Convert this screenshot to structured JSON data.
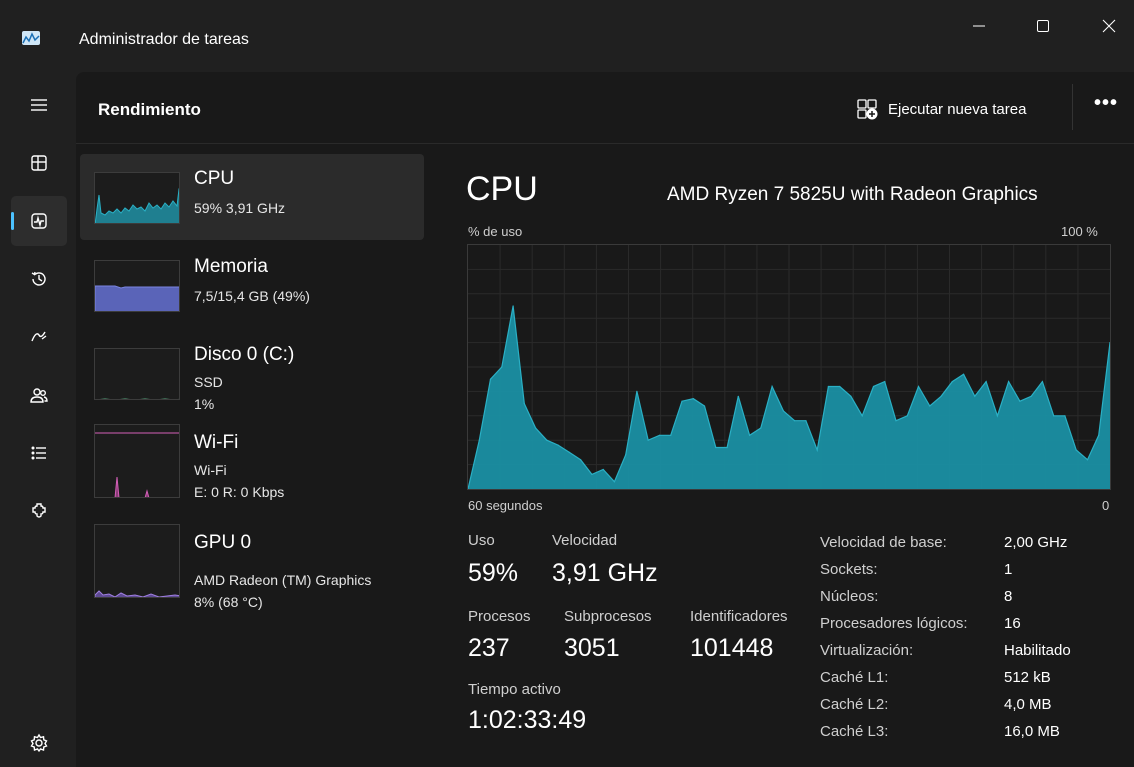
{
  "app": {
    "title": "Administrador de tareas"
  },
  "window_controls": [
    "minimize",
    "maximize",
    "close"
  ],
  "nav": {
    "items": [
      {
        "icon": "menu-icon"
      },
      {
        "icon": "processes-icon"
      },
      {
        "icon": "performance-icon",
        "active": true
      },
      {
        "icon": "history-icon"
      },
      {
        "icon": "startup-icon"
      },
      {
        "icon": "users-icon"
      },
      {
        "icon": "details-icon"
      },
      {
        "icon": "services-icon"
      },
      {
        "icon": "settings-icon"
      }
    ]
  },
  "header": {
    "title": "Rendimiento",
    "run_task": "Ejecutar nueva tarea",
    "more": "•••"
  },
  "devices": [
    {
      "name": "CPU",
      "line1": "59% 3,91 GHz",
      "color": "#2ab0c5",
      "active": true
    },
    {
      "name": "Memoria",
      "line1": "7,5/15,4 GB (49%)",
      "color": "#7a85e0"
    },
    {
      "name": "Disco 0 (C:)",
      "line1": "SSD",
      "line2": "1%",
      "color": "#5fb88a"
    },
    {
      "name": "Wi-Fi",
      "line1": "Wi-Fi",
      "line2": "E: 0 R: 0 Kbps",
      "color": "#d35fb7"
    },
    {
      "name": "GPU 0",
      "line1": "AMD Radeon (TM) Graphics",
      "line2": "8% (68 °C)",
      "color": "#9f7fe0"
    }
  ],
  "detail": {
    "title": "CPU",
    "model": "AMD Ryzen 7 5825U with Radeon Graphics",
    "usage_label": "% de uso",
    "max_label": "100 %",
    "time_label": "60 segundos",
    "min_label": "0",
    "stats": {
      "uso_label": "Uso",
      "uso": "59%",
      "velocidad_label": "Velocidad",
      "velocidad": "3,91 GHz",
      "procesos_label": "Procesos",
      "procesos": "237",
      "subprocesos_label": "Subprocesos",
      "subprocesos": "3051",
      "identificadores_label": "Identificadores",
      "identificadores": "101448",
      "tiempo_label": "Tiempo activo",
      "tiempo": "1:02:33:49"
    },
    "specs": [
      {
        "label": "Velocidad de base:",
        "value": "2,00 GHz"
      },
      {
        "label": "Sockets:",
        "value": "1"
      },
      {
        "label": "Núcleos:",
        "value": "8"
      },
      {
        "label": "Procesadores lógicos:",
        "value": "16"
      },
      {
        "label": "Virtualización:",
        "value": "Habilitado"
      },
      {
        "label": "Caché L1:",
        "value": "512 kB"
      },
      {
        "label": "Caché L2:",
        "value": "4,0 MB"
      },
      {
        "label": "Caché L3:",
        "value": "16,0 MB"
      }
    ]
  },
  "chart_data": {
    "type": "area",
    "ylim": [
      0,
      100
    ],
    "grid": true,
    "color": "#2ab0c5",
    "values": [
      0,
      20,
      45,
      50,
      75,
      35,
      25,
      20,
      18,
      15,
      12,
      6,
      8,
      3,
      14,
      40,
      20,
      22,
      22,
      36,
      37,
      34,
      17,
      17,
      38,
      22,
      25,
      42,
      32,
      28,
      28,
      16,
      42,
      42,
      38,
      30,
      42,
      44,
      28,
      30,
      42,
      34,
      38,
      44,
      47,
      38,
      44,
      30,
      44,
      36,
      38,
      44,
      30,
      30,
      16,
      12,
      22,
      60
    ]
  }
}
